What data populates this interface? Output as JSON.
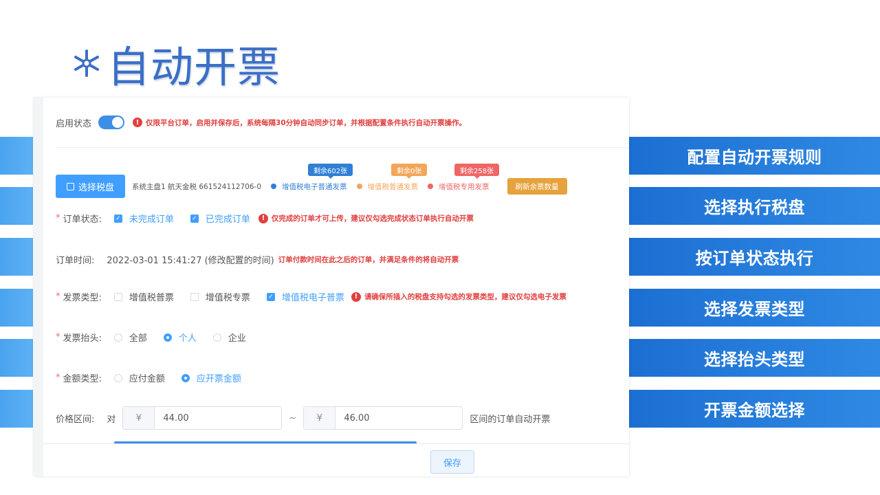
{
  "slide": {
    "title": "自动开票"
  },
  "right_labels": [
    "配置自动开票规则",
    "选择执行税盘",
    "按订单状态执行",
    "选择发票类型",
    "选择抬头类型",
    "开票金额选择"
  ],
  "form": {
    "enable": {
      "label": "启用状态",
      "on": true,
      "notice": "仅限平台订单，启用并保存后，系统每隔30分钟自动同步订单，并根据配置条件执行自动开票操作。"
    },
    "disk": {
      "button": "选择税盘",
      "info": "系统主盘1 航天金税 661524112706-0",
      "types": [
        {
          "label": "增值税电子普通发票",
          "remain": "剩余602张",
          "color": "#2f7fd6"
        },
        {
          "label": "增值税普通发票",
          "remain": "剩余0张",
          "color": "#f2a65a"
        },
        {
          "label": "增值税专用发票",
          "remain": "剩余258张",
          "color": "#ee6666"
        }
      ],
      "refresh_button": "刷新余票数量"
    },
    "order_status": {
      "label": "订单状态:",
      "options": [
        {
          "label": "未完成订单",
          "checked": true
        },
        {
          "label": "已完成订单",
          "checked": true
        }
      ],
      "notice": "仅完成的订单才可上传，建议仅勾选完成状态订单执行自动开票"
    },
    "order_time": {
      "label": "订单时间:",
      "value": "2022-03-01 15:41:27 (修改配置的时间)",
      "notice": "订单付款时间在此之后的订单，并满足条件的将自动开票"
    },
    "invoice_type": {
      "label": "发票类型:",
      "options": [
        {
          "label": "增值税普票",
          "checked": false
        },
        {
          "label": "增值税专票",
          "checked": false
        },
        {
          "label": "增值税电子普票",
          "checked": true
        }
      ],
      "notice": "请确保所插入的税盘支持勾选的发票类型，建议仅勾选电子发票"
    },
    "invoice_header": {
      "label": "发票抬头:",
      "options": [
        {
          "label": "全部",
          "selected": false
        },
        {
          "label": "个人",
          "selected": true
        },
        {
          "label": "企业",
          "selected": false
        }
      ]
    },
    "amount_type": {
      "label": "金额类型:",
      "options": [
        {
          "label": "应付金额",
          "selected": false
        },
        {
          "label": "应开票金额",
          "selected": true
        }
      ]
    },
    "price_range": {
      "label": "价格区间:",
      "prefix": "对",
      "currency": "¥",
      "min": "44.00",
      "separator": "~",
      "max": "46.00",
      "suffix": "区间的订单自动开票"
    },
    "save_button": "保存"
  }
}
